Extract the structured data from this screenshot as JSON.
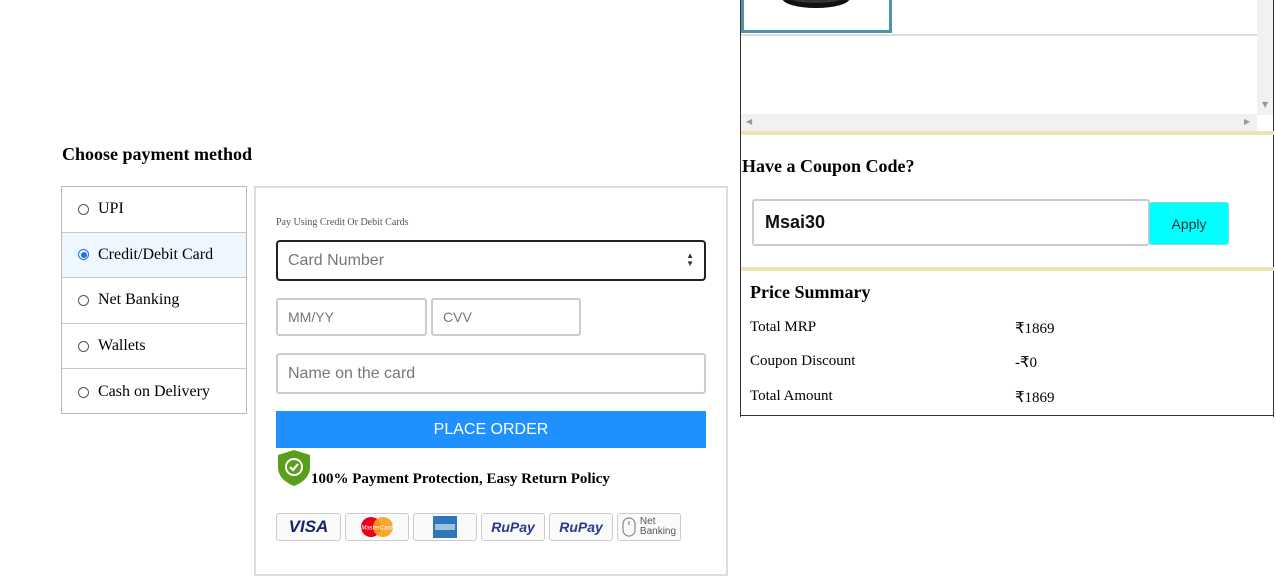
{
  "payment": {
    "title": "Choose payment method",
    "methods": [
      {
        "label": "UPI",
        "selected": false
      },
      {
        "label": "Credit/Debit Card",
        "selected": true
      },
      {
        "label": "Net Banking",
        "selected": false
      },
      {
        "label": "Wallets",
        "selected": false
      },
      {
        "label": "Cash on Delivery",
        "selected": false
      }
    ]
  },
  "card_form": {
    "subtitle": "Pay Using Credit Or Debit Cards",
    "card_number_placeholder": "Card Number",
    "expiry_placeholder": "MM/YY",
    "cvv_placeholder": "CVV",
    "name_placeholder": "Name on the card",
    "place_order_label": "PLACE ORDER",
    "protection_text": "100% Payment Protection, Easy Return Policy",
    "card_logos": {
      "visa": "VISA",
      "mastercard": "MasterCard",
      "rupay_1": "RuPay",
      "rupay_2": "RuPay",
      "net_line1": "Net",
      "net_line2": "Banking"
    }
  },
  "coupon": {
    "title": "Have a Coupon Code?",
    "value": "Msai30",
    "apply_label": "Apply"
  },
  "summary": {
    "title": "Price Summary",
    "rows": [
      {
        "label": "Total MRP",
        "value": "₹1869"
      },
      {
        "label": "Coupon Discount",
        "value": "-₹0"
      },
      {
        "label": "Total Amount",
        "value": "₹1869"
      }
    ]
  },
  "colors": {
    "primary_button": "#1e90ff",
    "apply_button": "#00ffff",
    "shield": "#5a9e1e",
    "divider": "#efe4b0"
  }
}
